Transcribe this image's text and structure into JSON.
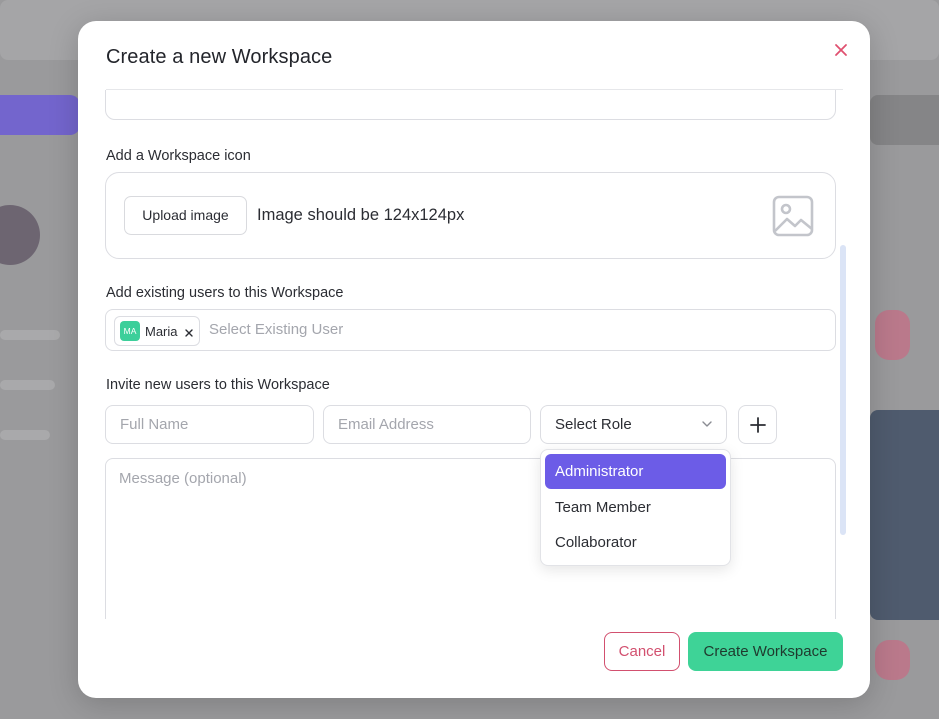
{
  "modal": {
    "title": "Create a new Workspace",
    "close_icon": "close-icon"
  },
  "icon_section": {
    "label": "Add a Workspace icon",
    "upload_button": "Upload image",
    "hint": "Image should be 124x124px",
    "placeholder_icon": "image-icon"
  },
  "existing_users": {
    "label": "Add existing users to this Workspace",
    "selected": [
      {
        "initials": "MA",
        "name": "Maria",
        "avatar_color": "#3ccf9a"
      }
    ],
    "placeholder": "Select Existing User"
  },
  "invite": {
    "label": "Invite new users to this Workspace",
    "full_name_placeholder": "Full Name",
    "email_placeholder": "Email Address",
    "role_value": "Select Role",
    "add_icon": "plus-icon",
    "message_placeholder": "Message (optional)"
  },
  "role_dropdown": {
    "options": [
      "Administrator",
      "Team Member",
      "Collaborator"
    ],
    "highlighted": "Administrator",
    "highlight_color": "#6c5ce7"
  },
  "footer": {
    "cancel_label": "Cancel",
    "create_label": "Create Workspace",
    "create_color": "#3ed397",
    "cancel_color": "#d2506f"
  }
}
